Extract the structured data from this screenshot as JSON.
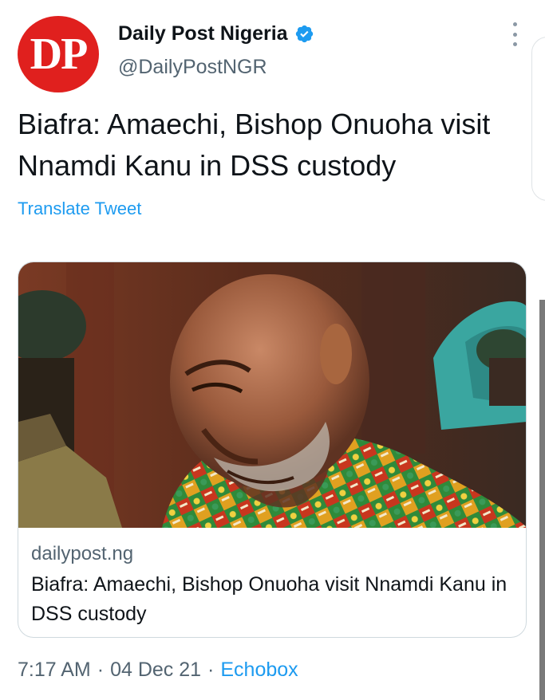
{
  "author": {
    "avatar_text": "DP",
    "display_name": "Daily Post Nigeria",
    "handle": "@DailyPostNGR",
    "verified": true
  },
  "tweet": {
    "text": "Biafra: Amaechi, Bishop Onuoha visit Nnamdi Kanu in DSS custody",
    "translate_label": "Translate Tweet"
  },
  "card": {
    "domain": "dailypost.ng",
    "title": "Biafra: Amaechi, Bishop Onuoha visit Nnamdi Kanu in DSS custody"
  },
  "meta": {
    "time": "7:17 AM",
    "separator_1": "·",
    "date": "04 Dec 21",
    "separator_2": "·",
    "source": "Echobox"
  },
  "icons": {
    "verified": "verified-badge-icon",
    "more": "more-options-icon"
  },
  "colors": {
    "avatar_bg": "#e0201e",
    "link_blue": "#1d9bf0",
    "secondary_text": "#536471",
    "primary_text": "#0f1419"
  }
}
